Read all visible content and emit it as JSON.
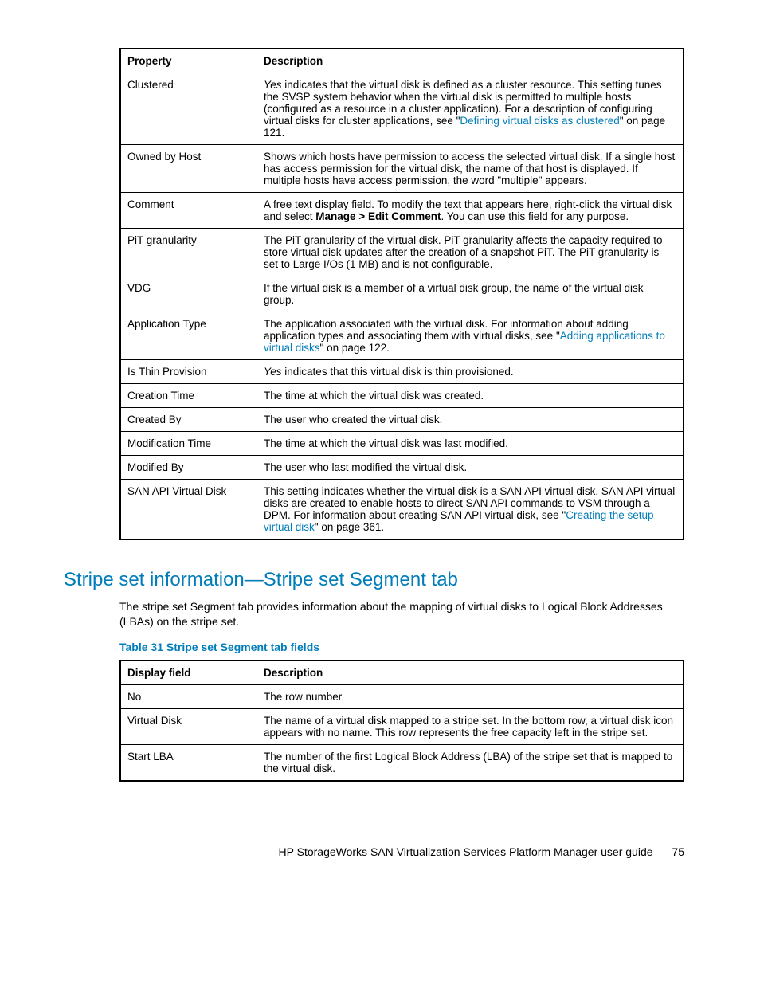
{
  "table1": {
    "headers": {
      "c1": "Property",
      "c2": "Description"
    },
    "rows": [
      {
        "prop": "Clustered",
        "desc_pre_italic": "Yes",
        "desc_post_italic": " indicates that the virtual disk is defined as a cluster resource. This setting tunes the SVSP system behavior when the virtual disk is permitted to multiple hosts (configured as a resource in a cluster application). For a description of configuring virtual disks for cluster applications, see \"",
        "link": "Defining virtual disks as clustered",
        "desc_after_link": "\" on page 121."
      },
      {
        "prop": "Owned by Host",
        "desc": "Shows which hosts have permission to access the selected virtual disk. If a single host has access permission for the virtual disk, the name of that host is displayed. If multiple hosts have access permission, the word \"multiple\" appears."
      },
      {
        "prop": "Comment",
        "desc_pre": "A free text display field. To modify the text that appears here, right-click the virtual disk and select ",
        "bold": "Manage > Edit Comment",
        "desc_post": ". You can use this field for any purpose."
      },
      {
        "prop": "PiT granularity",
        "desc": "The PiT granularity of the virtual disk. PiT granularity affects the capacity required to store virtual disk updates after the creation of a snapshot PiT. The PiT granularity is set to Large I/Os (1 MB) and is not configurable."
      },
      {
        "prop": "VDG",
        "desc": "If the virtual disk is a member of a virtual disk group, the name of the virtual disk group."
      },
      {
        "prop": "Application Type",
        "desc_pre": "The application associated with the virtual disk. For information about adding application types and associating them with virtual disks, see \"",
        "link": "Adding applications to virtual disks",
        "desc_post": "\" on page 122."
      },
      {
        "prop": "Is Thin Provision",
        "desc_pre_italic": "Yes",
        "desc_post_italic": " indicates that this virtual disk is thin provisioned."
      },
      {
        "prop": "Creation Time",
        "desc": "The time at which the virtual disk was created."
      },
      {
        "prop": "Created By",
        "desc": "The user who created the virtual disk."
      },
      {
        "prop": "Modification Time",
        "desc": "The time at which the virtual disk was last modified."
      },
      {
        "prop": "Modified By",
        "desc": "The user who last modified the virtual disk."
      },
      {
        "prop": "SAN API Virtual Disk",
        "desc_pre": "This setting indicates whether the virtual disk is a SAN API virtual disk. SAN API virtual disks are created to enable hosts to direct SAN API commands to VSM through a DPM. For information about creating SAN API virtual disk, see \"",
        "link": "Creating the setup virtual disk",
        "desc_post": "\" on page 361."
      }
    ]
  },
  "section_heading": "Stripe set information—Stripe set Segment tab",
  "section_body": "The stripe set Segment tab provides information about the mapping of virtual disks to Logical Block Addresses (LBAs) on the stripe set.",
  "table2_caption": "Table 31 Stripe set Segment tab fields",
  "table2": {
    "headers": {
      "c1": "Display field",
      "c2": "Description"
    },
    "rows": [
      {
        "prop": "No",
        "desc": "The row number."
      },
      {
        "prop": "Virtual Disk",
        "desc": "The name of a virtual disk mapped to a stripe set. In the bottom row, a virtual disk icon appears with no name. This row represents the free capacity left in the stripe set."
      },
      {
        "prop": "Start LBA",
        "desc": "The number of the first Logical Block Address (LBA) of the stripe set that is mapped to the virtual disk."
      }
    ]
  },
  "footer": {
    "title": "HP StorageWorks SAN Virtualization Services Platform Manager user guide",
    "page": "75"
  }
}
